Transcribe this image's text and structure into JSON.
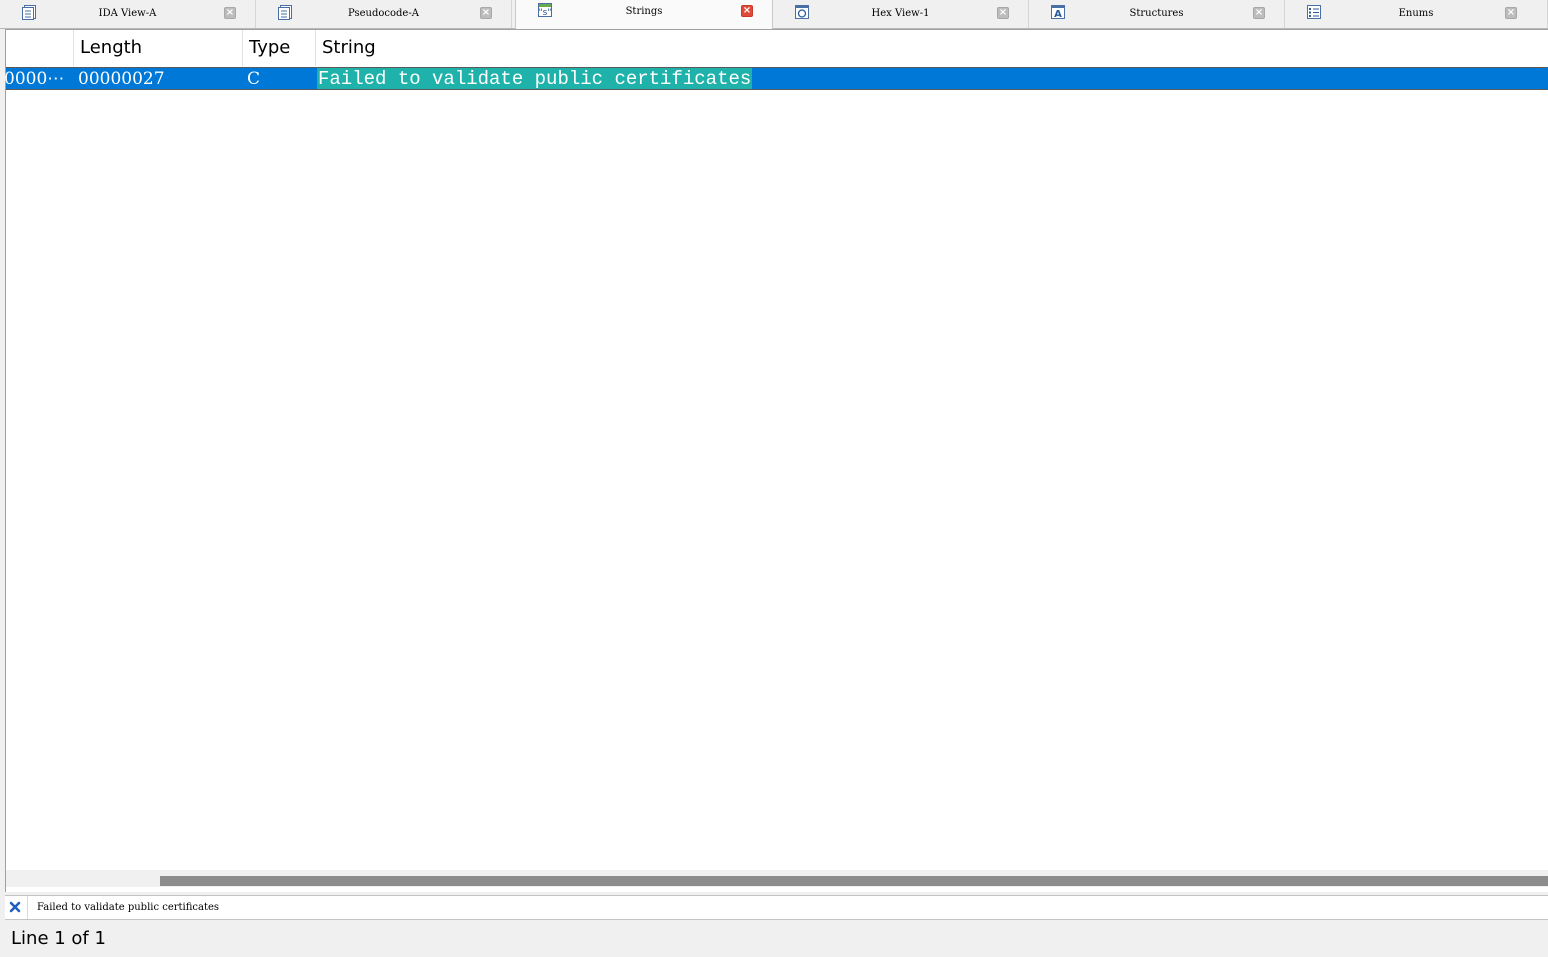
{
  "tabs": [
    {
      "label": "IDA View-A",
      "icon": "ida-view-icon",
      "active": false
    },
    {
      "label": "Pseudocode-A",
      "icon": "pseudocode-icon",
      "active": false
    },
    {
      "label": "Strings",
      "icon": "strings-icon",
      "active": true
    },
    {
      "label": "Hex View-1",
      "icon": "hex-view-icon",
      "active": false
    },
    {
      "label": "Structures",
      "icon": "structures-icon",
      "active": false
    },
    {
      "label": "Enums",
      "icon": "enums-icon",
      "active": false
    }
  ],
  "table": {
    "columns": [
      "",
      "Length",
      "Type",
      "String"
    ],
    "rows": [
      {
        "address": "0000⋯",
        "length": "00000027",
        "type": "C",
        "string": "Failed to validate public certificates"
      }
    ]
  },
  "output": {
    "icon": "close-x-icon",
    "text": "Failed to validate public certificates"
  },
  "status": {
    "text": "Line 1 of 1"
  },
  "colors": {
    "selection": "#0078d7",
    "highlight": "#1fb2aa",
    "active_close": "#e04a3b"
  }
}
